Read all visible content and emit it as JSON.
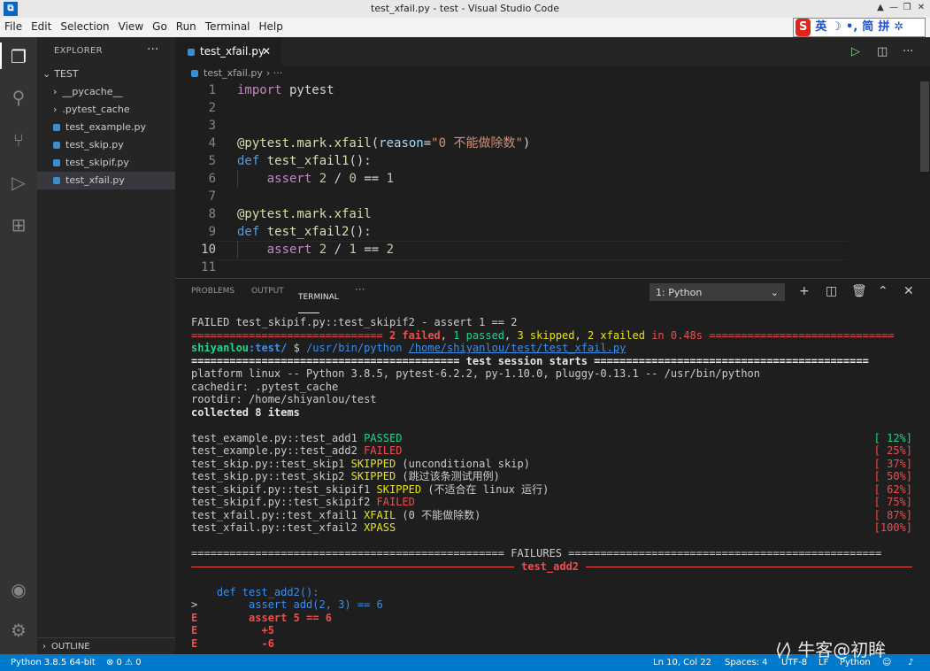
{
  "window": {
    "title": "test_xfail.py - test - Visual Studio Code"
  },
  "menubar": [
    "File",
    "Edit",
    "Selection",
    "View",
    "Go",
    "Run",
    "Terminal",
    "Help"
  ],
  "ime": {
    "logo": "S",
    "lang": "英",
    "simp": "简",
    "pinyin": "拼"
  },
  "sidebar": {
    "header": "EXPLORER",
    "folder": "TEST",
    "items": [
      "__pycache__",
      ".pytest_cache",
      "test_example.py",
      "test_skip.py",
      "test_skipif.py",
      "test_xfail.py"
    ],
    "outline": "OUTLINE"
  },
  "editor": {
    "tab": "test_xfail.py",
    "breadcrumb": "test_xfail.py",
    "lines": [
      {
        "n": "1",
        "t": "import pytest"
      },
      {
        "n": "2",
        "t": ""
      },
      {
        "n": "3",
        "t": ""
      },
      {
        "n": "4",
        "t": "@pytest.mark.xfail(reason=\"0 不能做除数\")"
      },
      {
        "n": "5",
        "t": "def test_xfail1():"
      },
      {
        "n": "6",
        "t": "    assert 2 / 0 == 1"
      },
      {
        "n": "7",
        "t": ""
      },
      {
        "n": "8",
        "t": "@pytest.mark.xfail"
      },
      {
        "n": "9",
        "t": "def test_xfail2():"
      },
      {
        "n": "10",
        "t": "    assert 2 / 1 == 2"
      },
      {
        "n": "11",
        "t": ""
      }
    ]
  },
  "panel": {
    "tabs": [
      "PROBLEMS",
      "OUTPUT",
      "TERMINAL"
    ],
    "terminal_select": "1: Python"
  },
  "terminal": {
    "l1": "FAILED test_skipif.py::test_skipif2 - assert 1 == 2",
    "summary": {
      "eq_l": "============================== ",
      "failed": "2 failed",
      "sep1": ", ",
      "passed": "1 passed",
      "sep2": ", ",
      "skipped": "3 skipped",
      "sep3": ", ",
      "xfailed": "2 xfailed",
      "in": " in 0.48s",
      "eq_r": " ============================="
    },
    "prompt": {
      "user": "shiyanlou",
      "path": ":test/",
      "dollar": " $ ",
      "cmd": "/usr/bin/python ",
      "file": "/home/shiyanlou/test/test_xfail.py"
    },
    "session": "========================================== test session starts ===========================================",
    "platform": "platform linux -- Python 3.8.5, pytest-6.2.2, py-1.10.0, pluggy-0.13.1 -- /usr/bin/python",
    "cachedir": "cachedir: .pytest_cache",
    "rootdir": "rootdir: /home/shiyanlou/test",
    "collected": "collected 8 items",
    "results": [
      {
        "name": "test_example.py::test_add1 ",
        "status": "PASSED",
        "extra": "",
        "pct": "[ 12%]"
      },
      {
        "name": "test_example.py::test_add2 ",
        "status": "FAILED",
        "extra": "",
        "pct": "[ 25%]"
      },
      {
        "name": "test_skip.py::test_skip1 ",
        "status": "SKIPPED",
        "extra": " (unconditional skip)",
        "pct": "[ 37%]"
      },
      {
        "name": "test_skip.py::test_skip2 ",
        "status": "SKIPPED",
        "extra": " (跳过该条测试用例)",
        "pct": "[ 50%]"
      },
      {
        "name": "test_skipif.py::test_skipif1 ",
        "status": "SKIPPED",
        "extra": " (不适合在 linux 运行)",
        "pct": "[ 62%]"
      },
      {
        "name": "test_skipif.py::test_skipif2 ",
        "status": "FAILED",
        "extra": "",
        "pct": "[ 75%]"
      },
      {
        "name": "test_xfail.py::test_xfail1 ",
        "status": "XFAIL",
        "extra": " (0 不能做除数)",
        "pct": "[ 87%]"
      },
      {
        "name": "test_xfail.py::test_xfail2 ",
        "status": "XPASS",
        "extra": "",
        "pct": "[100%]"
      }
    ],
    "failures": "================================================= FAILURES =================================================",
    "fail_title": "test_add2",
    "trace": [
      {
        "p": "",
        "c": "    def test_add2():"
      },
      {
        "p": ">",
        "c": "        assert add(2, 3) == 6"
      },
      {
        "p": "E",
        "c": "        assert 5 == 6"
      },
      {
        "p": "E",
        "c": "          +5"
      },
      {
        "p": "E",
        "c": "          -6"
      }
    ]
  },
  "statusbar": {
    "python": "Python 3.8.5 64-bit",
    "problems": "⊗ 0 ⚠ 0",
    "position": "Ln 10, Col 22",
    "spaces": "Spaces: 4",
    "encoding": "UTF-8",
    "eol": "LF",
    "lang": "Python"
  },
  "watermark": "牛客@初眸"
}
